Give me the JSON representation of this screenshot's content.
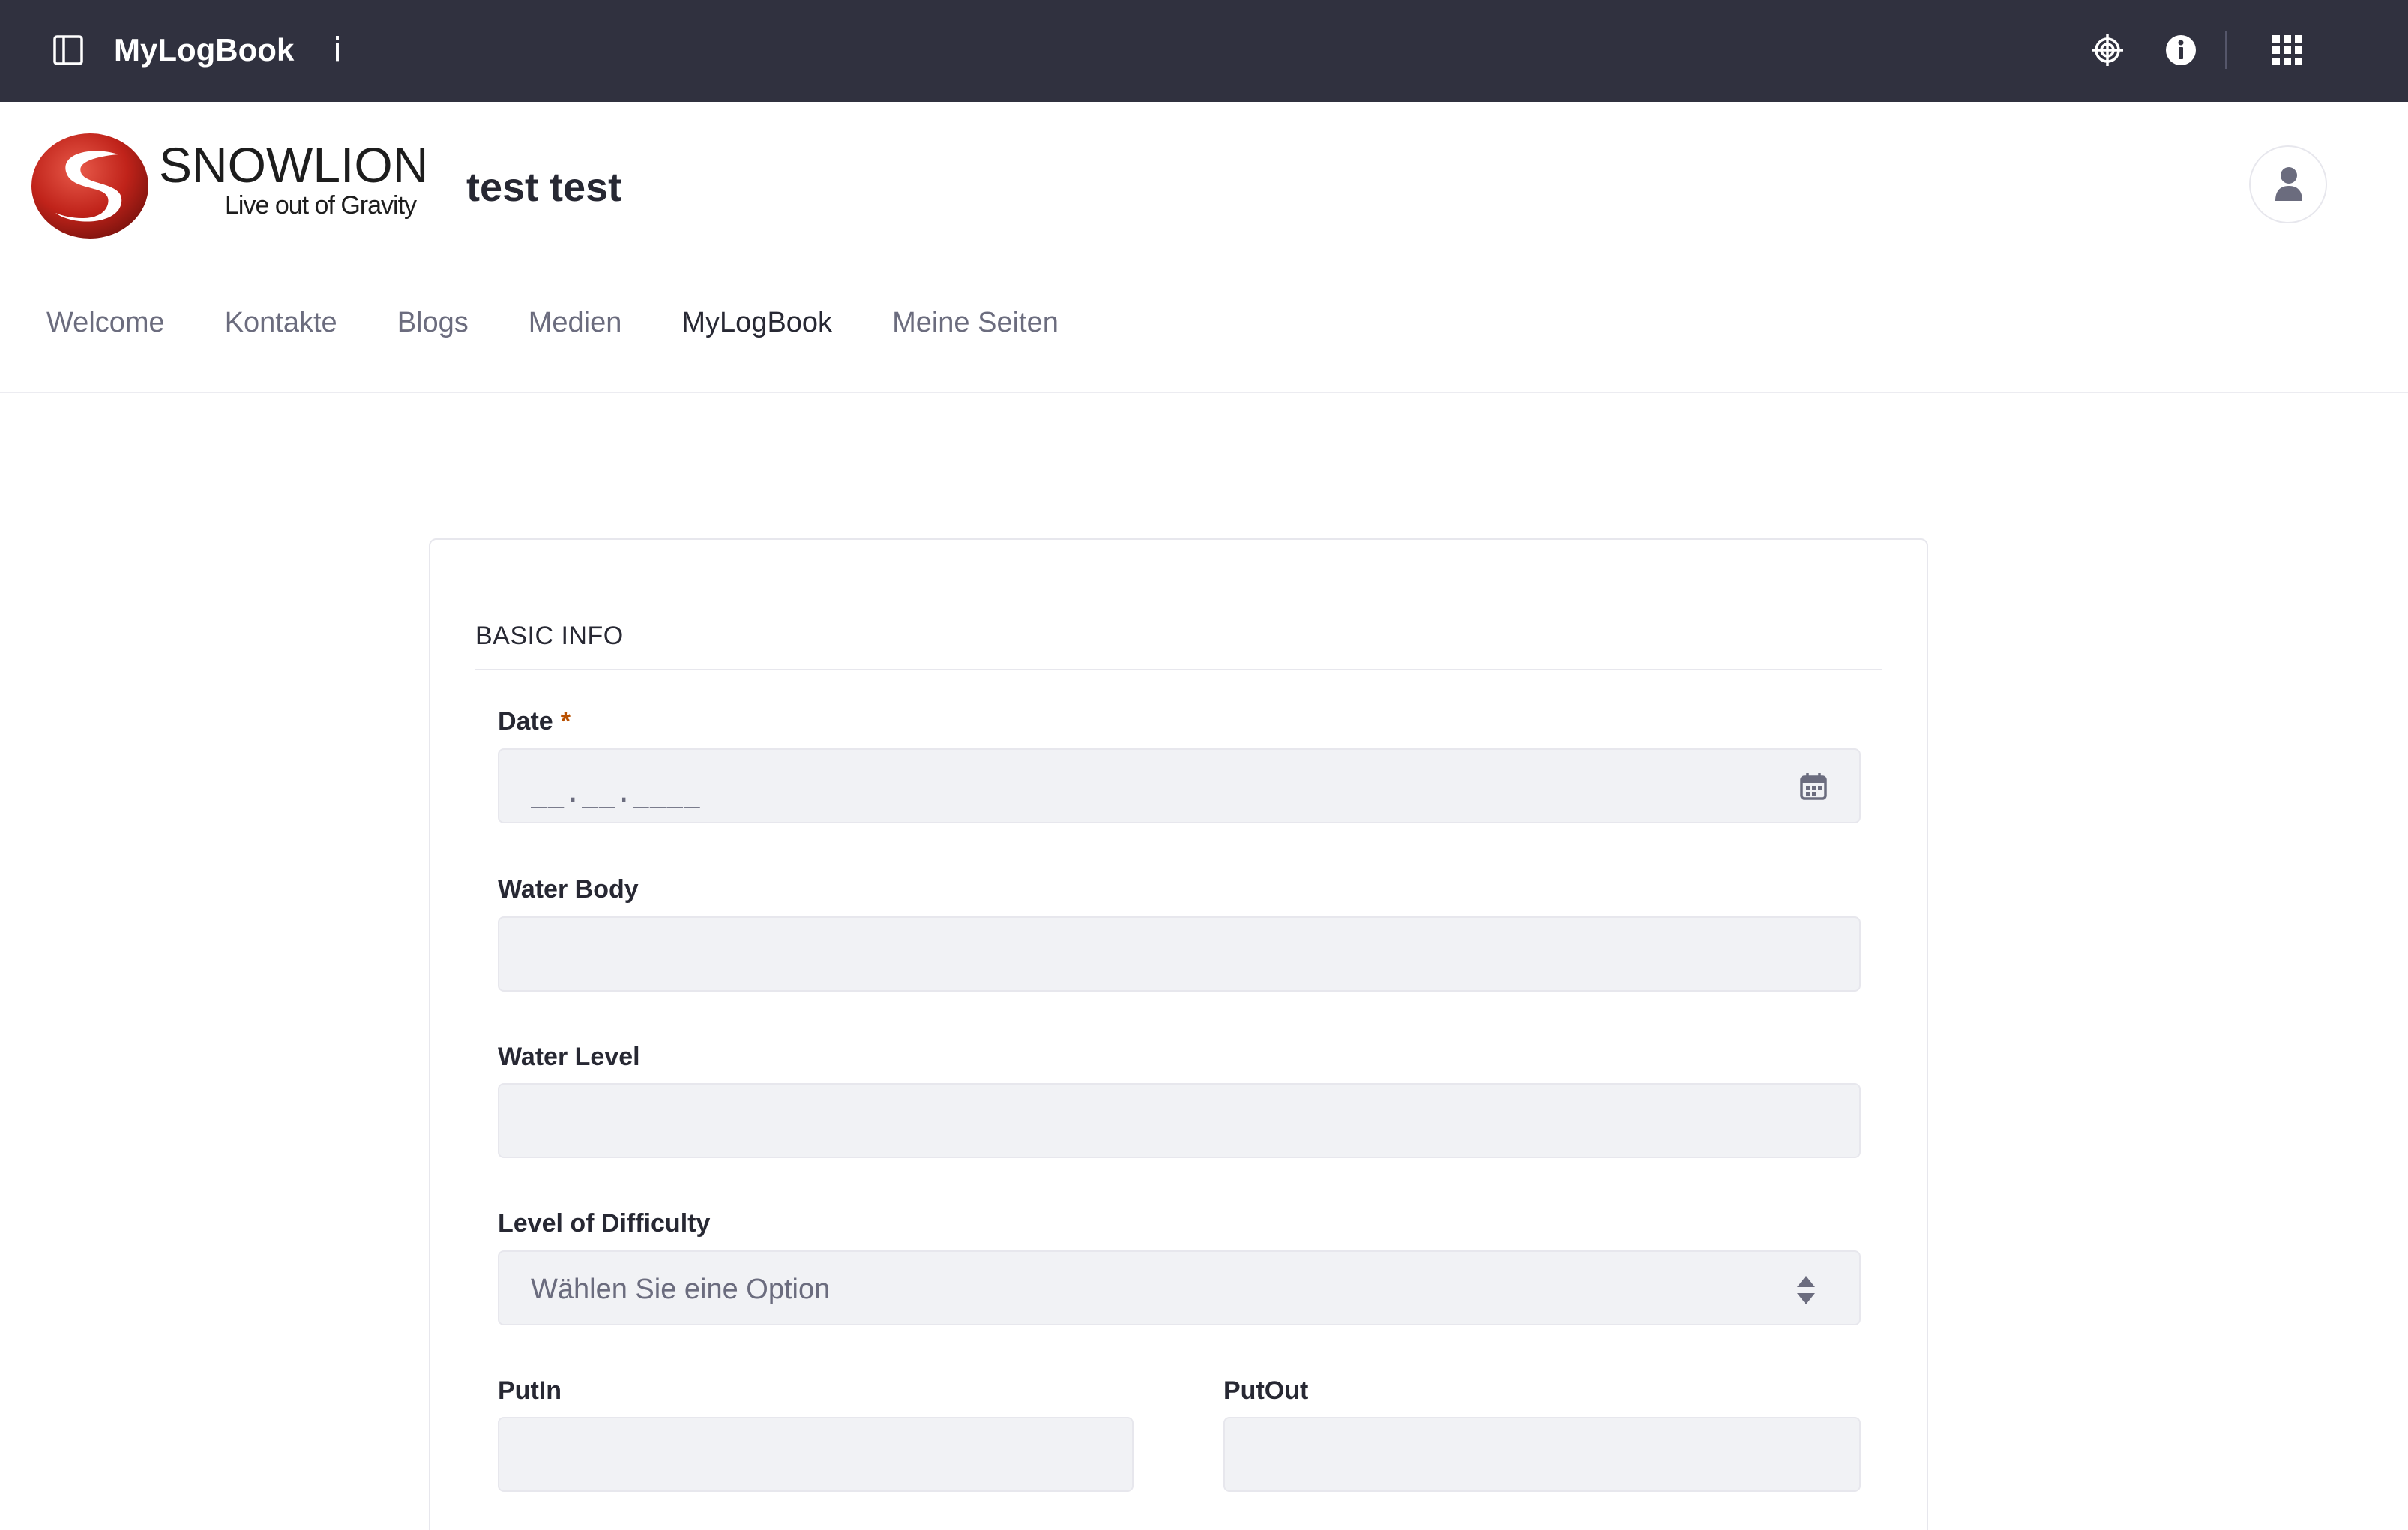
{
  "control_menu": {
    "title": "MyLogBook",
    "title_info_glyph": "i",
    "icons": {
      "panel_toggle": "sidebar-toggle-icon",
      "simulation": "simulation-target-icon",
      "info": "info-circle-icon",
      "apps": "apps-grid-icon"
    }
  },
  "header": {
    "logo_name": "SNOWLION",
    "logo_tagline": "Live out of Gravity",
    "site_name": "test test",
    "user_icon": "user-icon"
  },
  "nav": {
    "items": [
      {
        "label": "Welcome",
        "active": false
      },
      {
        "label": "Kontakte",
        "active": false
      },
      {
        "label": "Blogs",
        "active": false
      },
      {
        "label": "Medien",
        "active": false
      },
      {
        "label": "MyLogBook",
        "active": true
      },
      {
        "label": "Meine Seiten",
        "active": false
      }
    ]
  },
  "form": {
    "section_title": "BASIC INFO",
    "fields": {
      "date": {
        "label": "Date",
        "required_mark": "*",
        "placeholder": "__.__.____",
        "icon": "calendar-icon"
      },
      "water_body": {
        "label": "Water Body",
        "value": ""
      },
      "water_level": {
        "label": "Water Level",
        "value": ""
      },
      "difficulty": {
        "label": "Level of Difficulty",
        "selected": "Wählen Sie eine Option",
        "icon": "select-caret-icon"
      },
      "put_in": {
        "label": "PutIn",
        "value": ""
      },
      "put_out": {
        "label": "PutOut",
        "value": ""
      }
    }
  },
  "colors": {
    "topbar": "#30313f",
    "field_bg": "#f1f2f5",
    "logo_red": "#c0231a",
    "required": "#b95000"
  }
}
